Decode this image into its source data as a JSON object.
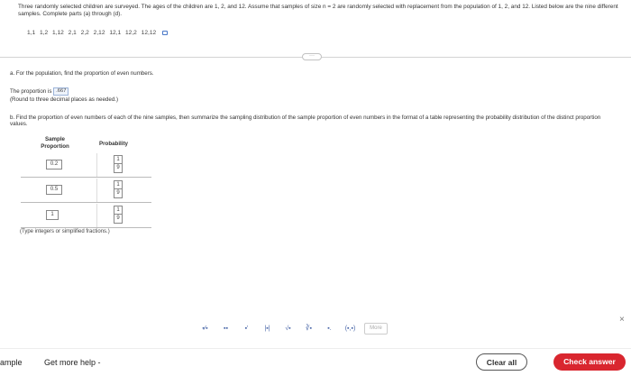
{
  "problem": {
    "text": "Three randomly selected children are surveyed. The ages of the children are 1, 2, and 12. Assume that samples of size n = 2 are randomly selected with replacement from the population of 1, 2, and 12. Listed below are the nine different samples. Complete parts (a) through (d).",
    "samples": "1,1  1,2  1,12  2,1  2,2  2,12  12,1  12,2  12,12"
  },
  "part_a": {
    "question": "a. For the population, find the proportion of even numbers.",
    "answer_prefix": "The proportion is",
    "answer_value": ".667",
    "note": "(Round to three decimal places as needed.)"
  },
  "part_b": {
    "question": "b. Find the proportion of even numbers of each of the nine samples, then summarize the sampling distribution of the sample proportion of even numbers in the format of a table representing the probability distribution of the distinct proportion values.",
    "col_proportion": "Sample Proportion",
    "col_probability": "Probability",
    "rows": [
      {
        "proportion": "0.2",
        "num": "1",
        "den": "9"
      },
      {
        "proportion": "0.5",
        "num": "1",
        "den": "9"
      },
      {
        "proportion": "1",
        "num": "1",
        "den": "9"
      }
    ],
    "hint": "(Type integers or simplified fractions.)"
  },
  "toolbar": {
    "tools": [
      "▪⁄▪",
      "▪▪",
      "▪'",
      "|▪|",
      "√▪",
      "∛▪",
      "▪.",
      "(▪,▪)"
    ],
    "more_label": "More",
    "close_symbol": "×"
  },
  "footer": {
    "sample_label": "ample",
    "help_label": "Get more help -",
    "clear_label": "Clear all",
    "check_label": "Check answer"
  },
  "colors": {
    "check_button": "#d9262f",
    "answer_box": "#eef3fb"
  }
}
